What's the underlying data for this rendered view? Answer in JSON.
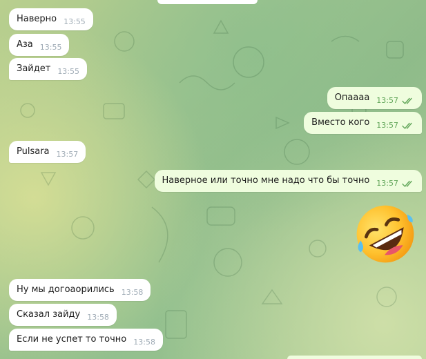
{
  "messages": [
    {
      "text": "Наверно",
      "time": "13:55",
      "dir": "in"
    },
    {
      "text": "Аза",
      "time": "13:55",
      "dir": "in"
    },
    {
      "text": "Зайдет",
      "time": "13:55",
      "dir": "in"
    },
    {
      "text": "Опаааа",
      "time": "13:57",
      "dir": "out"
    },
    {
      "text": "Вместо кого",
      "time": "13:57",
      "dir": "out"
    },
    {
      "text": "Pulsara",
      "time": "13:57",
      "dir": "in"
    },
    {
      "text": "Наверное или точно мне надо что бы точно",
      "time": "13:57",
      "dir": "out"
    },
    {
      "text": "Ну мы догоаорились",
      "time": "13:58",
      "dir": "in"
    },
    {
      "text": "Сказал зайду",
      "time": "13:58",
      "dir": "in"
    },
    {
      "text": "Если не успет то точно",
      "time": "13:58",
      "dir": "in"
    }
  ],
  "sticker": {
    "icon": "rolling-on-floor-laughing-emoji"
  },
  "colors": {
    "incoming_bubble": "#ffffff",
    "outgoing_bubble": "#effdde",
    "outgoing_time": "#62a65a",
    "incoming_time": "#a0acb6"
  }
}
